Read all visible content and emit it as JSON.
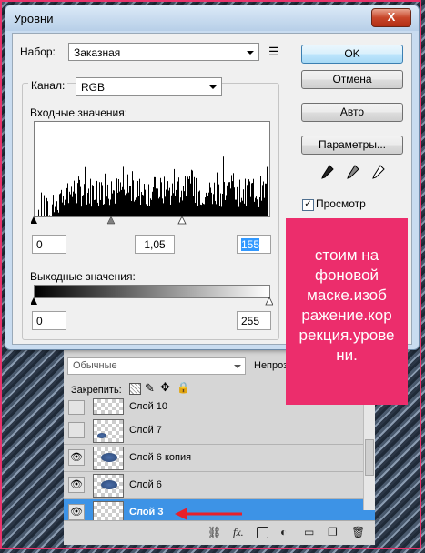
{
  "dialog": {
    "title": "Уровни",
    "close_label": "X",
    "preset": {
      "label": "Набор:",
      "value": "Заказная"
    },
    "channel": {
      "label": "Канал:",
      "value": "RGB"
    },
    "input_label": "Входные значения:",
    "input_values": {
      "black": "0",
      "gamma": "1,05",
      "white": "155"
    },
    "output_label": "Выходные значения:",
    "output_values": {
      "black": "0",
      "white": "255"
    },
    "buttons": {
      "ok": "OK",
      "cancel": "Отмена",
      "auto": "Авто",
      "options": "Параметры..."
    },
    "preview": {
      "label": "Просмотр",
      "checked": true
    }
  },
  "layers_panel": {
    "blend_mode": "Обычные",
    "opacity_label": "Непрозр",
    "lock_label": "Закрепить:",
    "layers": [
      {
        "name": "Слой 10",
        "visible": false,
        "selected": false
      },
      {
        "name": "Слой 7",
        "visible": false,
        "selected": false
      },
      {
        "name": "Слой 6 копия",
        "visible": true,
        "selected": false
      },
      {
        "name": "Слой 6",
        "visible": true,
        "selected": false
      },
      {
        "name": "Слой 3",
        "visible": true,
        "selected": true
      }
    ],
    "footer_icons": [
      "link-icon",
      "fx-icon",
      "mask-icon",
      "adjustment-icon",
      "folder-icon",
      "new-layer-icon",
      "trash-icon"
    ]
  },
  "annotation": {
    "text": "стоим на фоновой маске.изоб ражение.кор рекция.урове ни."
  },
  "colors": {
    "accent_pink": "#ec2d6c",
    "selection_blue": "#3d93e6",
    "arrow_red": "#e8202a"
  }
}
